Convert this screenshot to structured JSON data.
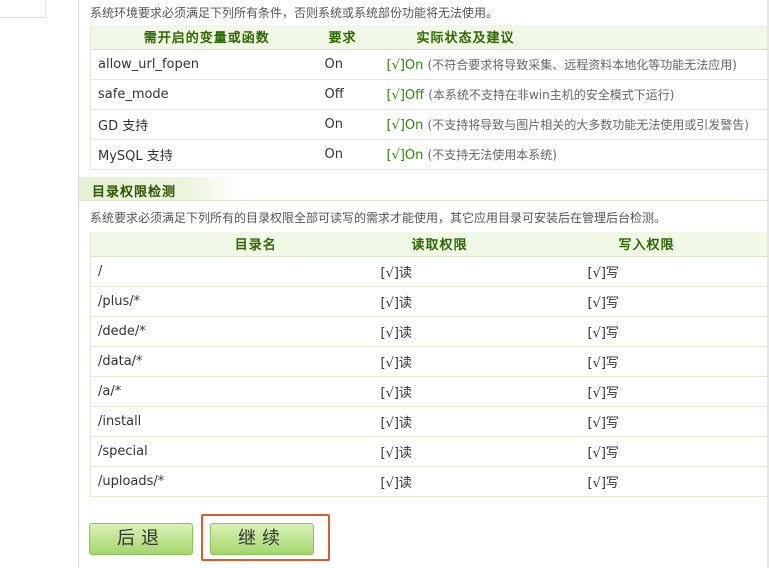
{
  "env": {
    "intro": "系统环境要求必须满足下列所有条件，否则系统或系统部份功能将无法使用。",
    "headers": [
      "需开启的变量或函数",
      "要求",
      "实际状态及建议"
    ],
    "rows": [
      {
        "name": "allow_url_fopen",
        "required": "On",
        "status": "[√]On",
        "note": "(不符合要求将导致采集、远程资料本地化等功能无法应用)"
      },
      {
        "name": "safe_mode",
        "required": "Off",
        "status": "[√]Off",
        "note": "(本系统不支持在非win主机的安全模式下运行)"
      },
      {
        "name": "GD 支持",
        "required": "On",
        "status": "[√]On",
        "note": "(不支持将导致与图片相关的大多数功能无法使用或引发警告)"
      },
      {
        "name": "MySQL 支持",
        "required": "On",
        "status": "[√]On",
        "note": "(不支持无法使用本系统)"
      }
    ]
  },
  "dirs": {
    "section_title": "目录权限检测",
    "intro": "系统要求必须满足下列所有的目录权限全部可读写的需求才能使用，其它应用目录可安装后在管理后台检测。",
    "headers": [
      "目录名",
      "读取权限",
      "写入权限"
    ],
    "rows": [
      {
        "name": "/",
        "read": "[√]读",
        "write": "[√]写"
      },
      {
        "name": "/plus/*",
        "read": "[√]读",
        "write": "[√]写"
      },
      {
        "name": "/dede/*",
        "read": "[√]读",
        "write": "[√]写"
      },
      {
        "name": "/data/*",
        "read": "[√]读",
        "write": "[√]写"
      },
      {
        "name": "/a/*",
        "read": "[√]读",
        "write": "[√]写"
      },
      {
        "name": "/install",
        "read": "[√]读",
        "write": "[√]写"
      },
      {
        "name": "/special",
        "read": "[√]读",
        "write": "[√]写"
      },
      {
        "name": "/uploads/*",
        "read": "[√]读",
        "write": "[√]写"
      }
    ]
  },
  "buttons": {
    "back": "后退",
    "next": "继续"
  },
  "colors": {
    "ok": "#2a8a00",
    "header_text": "#2d6a00",
    "highlight": "#e05a2b"
  }
}
